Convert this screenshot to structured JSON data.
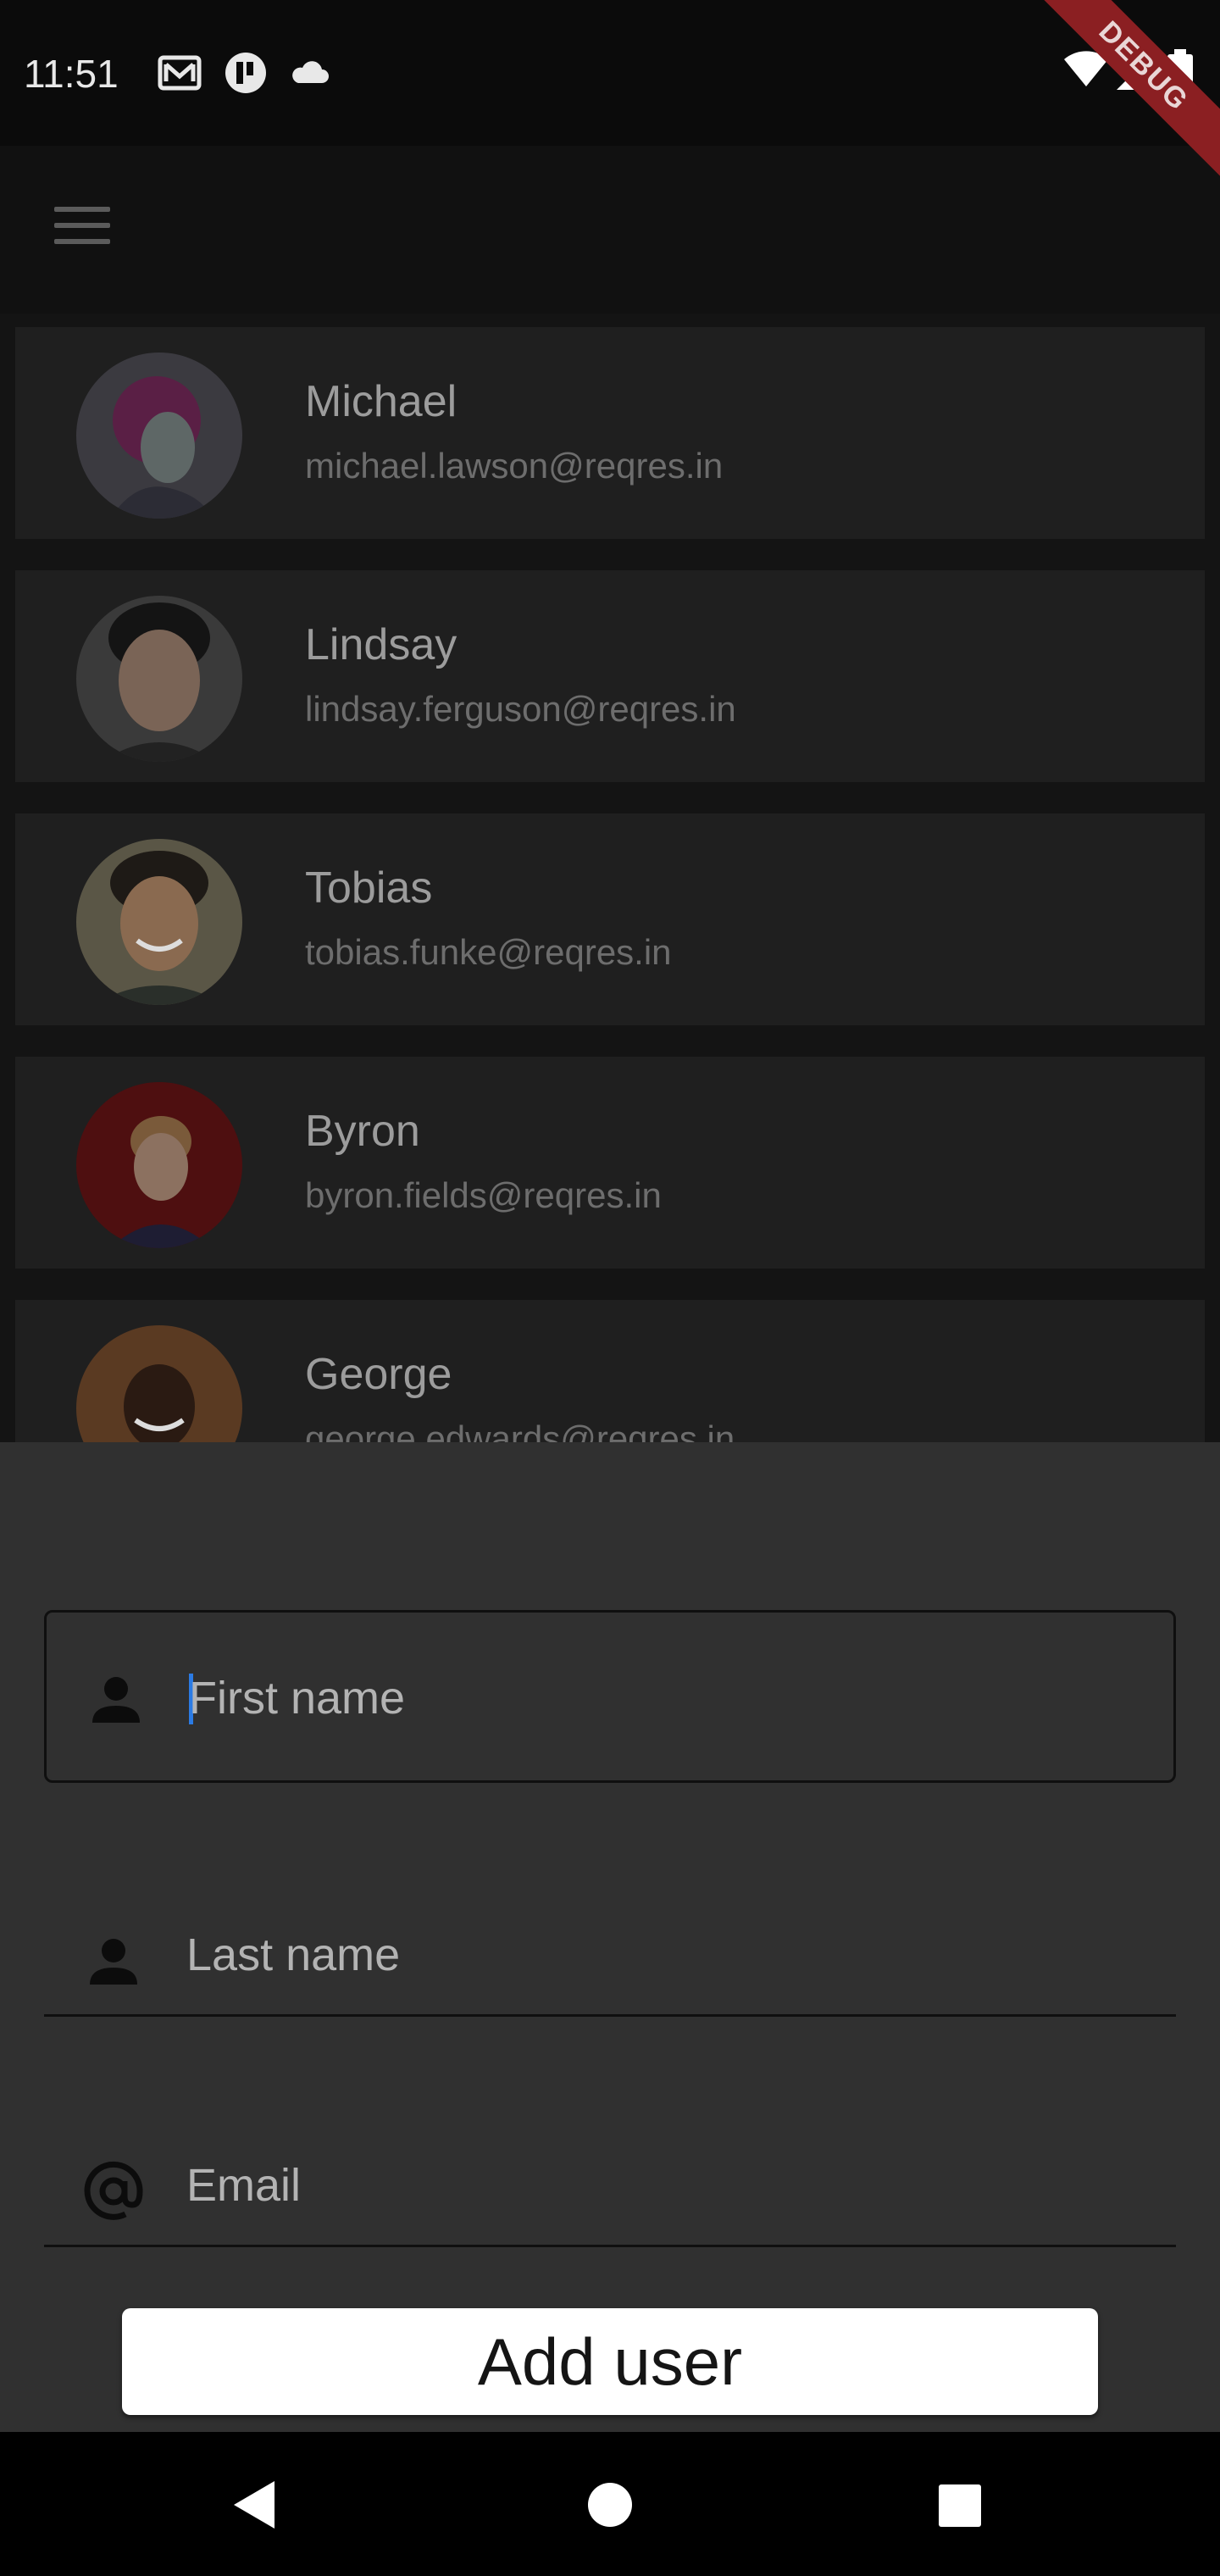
{
  "status_bar": {
    "time": "11:51",
    "icons": [
      "gmail-icon",
      "app-notification-icon",
      "cloud-icon",
      "wifi-icon",
      "signal-icon",
      "battery-icon"
    ]
  },
  "debug_banner": "DEBUG",
  "app_bar": {
    "menu_icon": "menu-icon"
  },
  "users": [
    {
      "name": "Michael",
      "email": "michael.lawson@reqres.in"
    },
    {
      "name": "Lindsay",
      "email": "lindsay.ferguson@reqres.in"
    },
    {
      "name": "Tobias",
      "email": "tobias.funke@reqres.in"
    },
    {
      "name": "Byron",
      "email": "byron.fields@reqres.in"
    },
    {
      "name": "George",
      "email": "george.edwards@reqres.in"
    }
  ],
  "form": {
    "first_name_placeholder": "First name",
    "last_name_placeholder": "Last name",
    "email_placeholder": "Email",
    "submit_label": "Add user"
  },
  "nav_bar": {
    "icons": [
      "back-icon",
      "home-icon",
      "recents-icon"
    ]
  },
  "colors": {
    "background": "#0a0a0a",
    "card": "#1f1f1f",
    "sheet": "#303030",
    "caret": "#2b7be4",
    "debug": "#8b1f22"
  }
}
